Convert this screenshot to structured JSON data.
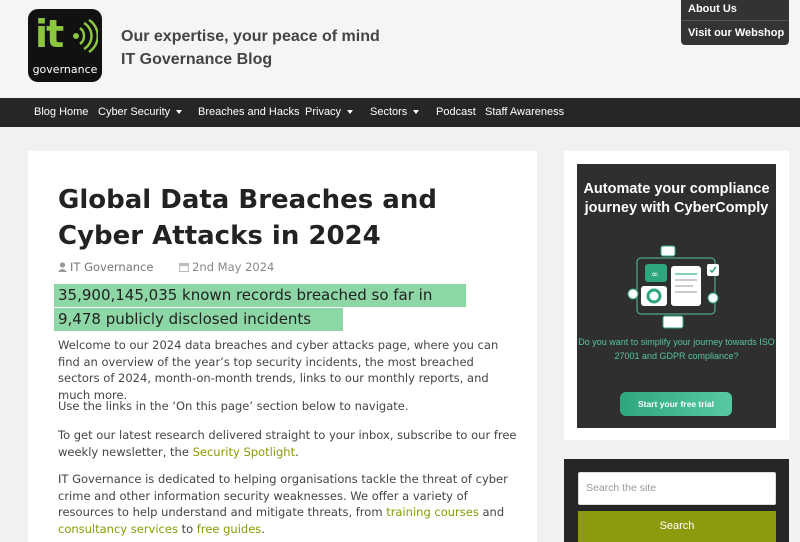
{
  "header": {
    "logo_text": "it",
    "logo_subtext": "governance",
    "tagline_line1": "Our expertise, your peace of mind",
    "tagline_line2": "IT Governance Blog",
    "top_links": [
      "About Us",
      "Visit our Webshop"
    ]
  },
  "nav": {
    "items": [
      {
        "label": "Blog Home",
        "has_dropdown": false
      },
      {
        "label": "Cyber Security",
        "has_dropdown": true
      },
      {
        "label": "Breaches and Hacks",
        "has_dropdown": false
      },
      {
        "label": "Privacy",
        "has_dropdown": true
      },
      {
        "label": "Sectors",
        "has_dropdown": true
      },
      {
        "label": "Podcast",
        "has_dropdown": false
      },
      {
        "label": "Staff Awareness",
        "has_dropdown": false
      }
    ]
  },
  "article": {
    "title": "Global Data Breaches and Cyber Attacks in 2024",
    "author": "IT Governance",
    "date": "2nd May 2024",
    "highlight_line1": "35,900,145,035 known records breached so far in",
    "highlight_line2": "9,478 publicly disclosed incidents",
    "para1": "Welcome to our 2024 data breaches and cyber attacks page, where you can find an overview of the year’s top security incidents, the most breached sectors of 2024, month-on-month trends, links to our monthly reports, and much more.",
    "para2": "Use the links in the ‘On this page’ section below to navigate.",
    "para3_before": "To get our latest research delivered straight to your inbox, subscribe to our free weekly newsletter, the ",
    "para3_link": "Security Spotlight",
    "para3_after": ".",
    "para4_before": "IT Governance is dedicated to helping organisations tackle the threat of cyber crime and other information security weaknesses. We offer a variety of resources to help understand and mitigate threats, from ",
    "para4_link1": "training courses",
    "para4_mid": " and ",
    "para4_link2": "consultancy services",
    "para4_mid2": " to ",
    "para4_link3": "free guides",
    "para4_after": "."
  },
  "sidebar": {
    "ad_headline": "Automate your compliance journey with CyberComply",
    "ad_copy": "Do you want to simplify your journey towards ISO 27001 and GDPR compliance?",
    "ad_button": "Start your free trial",
    "search_placeholder": "Search the site",
    "search_button": "Search"
  },
  "colors": {
    "nav_bg": "#262626",
    "highlight": "#8dd6a5",
    "link": "#8a9a08",
    "search_button": "#8e9a0d",
    "ad_accent": "#58c49b"
  }
}
